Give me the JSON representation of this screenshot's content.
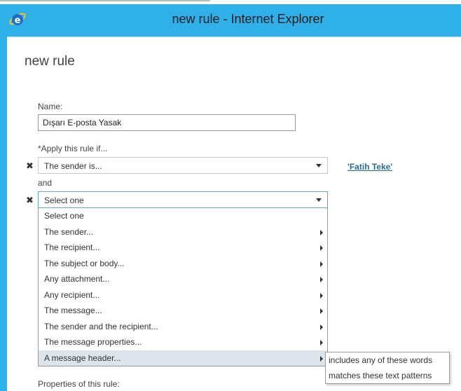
{
  "window": {
    "title": "new rule - Internet Explorer",
    "frame_color": "#2fb0e9"
  },
  "page": {
    "title": "new rule"
  },
  "form": {
    "name_label": "Name:",
    "name_value": "Dışarı E-posta Yasak",
    "apply_label": "*Apply this rule if...",
    "condition1_value": "The sender is...",
    "condition1_link": "'Fatih Teke'",
    "and_label": "and",
    "condition2_value": "Select one",
    "properties_label": "Properties of this rule:"
  },
  "dropdown": {
    "items": [
      {
        "label": "Select one",
        "has_submenu": false
      },
      {
        "label": "The sender...",
        "has_submenu": true
      },
      {
        "label": "The recipient...",
        "has_submenu": true
      },
      {
        "label": "The subject or body...",
        "has_submenu": true
      },
      {
        "label": "Any attachment...",
        "has_submenu": true
      },
      {
        "label": "Any recipient...",
        "has_submenu": true
      },
      {
        "label": "The message...",
        "has_submenu": true
      },
      {
        "label": "The sender and the recipient...",
        "has_submenu": true
      },
      {
        "label": "The message properties...",
        "has_submenu": true
      },
      {
        "label": "A message header...",
        "has_submenu": true,
        "highlighted": true
      }
    ]
  },
  "submenu": {
    "items": [
      {
        "label": "includes any of these words"
      },
      {
        "label": "matches these text patterns"
      }
    ]
  }
}
